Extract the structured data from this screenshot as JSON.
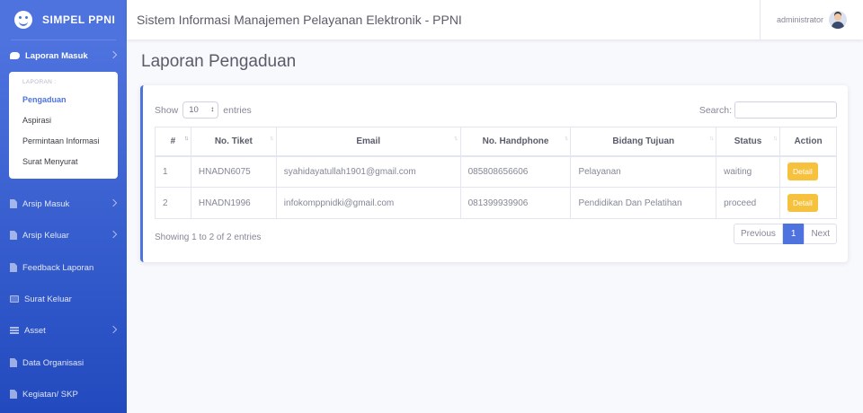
{
  "app": {
    "brand": "SIMPEL PPNI",
    "header_title": "Sistem Informasi Manajemen Pelayanan Elektronik - PPNI",
    "username": "administrator"
  },
  "sidebar": {
    "items": [
      {
        "label": "Laporan Masuk",
        "icon": "comments-icon"
      },
      {
        "label": "Arsip Masuk",
        "icon": "file-icon"
      },
      {
        "label": "Arsip Keluar",
        "icon": "file-icon"
      },
      {
        "label": "Feedback Laporan",
        "icon": "file-icon"
      },
      {
        "label": "Surat Keluar",
        "icon": "envelope-icon"
      },
      {
        "label": "Asset",
        "icon": "list-icon"
      },
      {
        "label": "Data Organisasi",
        "icon": "file-icon"
      },
      {
        "label": "Kegiatan/ SKP",
        "icon": "file-icon"
      }
    ],
    "submenu": {
      "header": "LAPORAN :",
      "items": [
        "Pengaduan",
        "Aspirasi",
        "Permintaan Informasi",
        "Surat Menyurat"
      ]
    }
  },
  "page": {
    "heading": "Laporan Pengaduan"
  },
  "table_controls": {
    "show_label": "Show",
    "entries_value": "10",
    "entries_label": "entries",
    "search_label": "Search:"
  },
  "table": {
    "columns": [
      "#",
      "No. Tiket",
      "Email",
      "No. Handphone",
      "Bidang Tujuan",
      "Status",
      "Action"
    ],
    "rows": [
      {
        "no": "1",
        "tiket": "HNADN6075",
        "email": "syahidayatullah1901@gmail.com",
        "hp": "085808656606",
        "bidang": "Pelayanan",
        "status": "waiting",
        "action": "Detail"
      },
      {
        "no": "2",
        "tiket": "HNADN1996",
        "email": "infokomppnidki@gmail.com",
        "hp": "081399939906",
        "bidang": "Pendidikan Dan Pelatihan",
        "status": "proceed",
        "action": "Detail"
      }
    ],
    "info": "Showing 1 to 2 of 2 entries"
  },
  "pagination": {
    "previous": "Previous",
    "current": "1",
    "next": "Next"
  },
  "colors": {
    "primary": "#4e73df",
    "warning": "#f6c23e"
  }
}
